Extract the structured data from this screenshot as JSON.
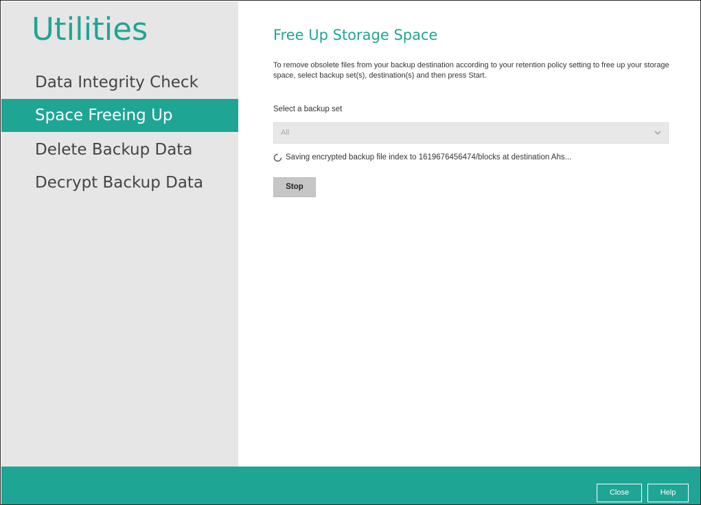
{
  "sidebar": {
    "title": "Utilities",
    "items": [
      {
        "label": "Data Integrity Check",
        "active": false
      },
      {
        "label": "Space Freeing Up",
        "active": true
      },
      {
        "label": "Delete Backup Data",
        "active": false
      },
      {
        "label": "Decrypt Backup Data",
        "active": false
      }
    ]
  },
  "main": {
    "title": "Free Up Storage Space",
    "description": "To remove obsolete files from your backup destination according to your retention policy setting to free up your storage space, select backup set(s), destination(s) and then press Start.",
    "select_label": "Select a backup set",
    "select_value": "All",
    "status_text": "Saving encrypted backup file index to 1619676456474/blocks at destination Ahs...",
    "stop_label": "Stop"
  },
  "footer": {
    "close_label": "Close",
    "help_label": "Help"
  },
  "colors": {
    "accent": "#1fa594",
    "sidebar_bg": "#e6e6e6"
  }
}
